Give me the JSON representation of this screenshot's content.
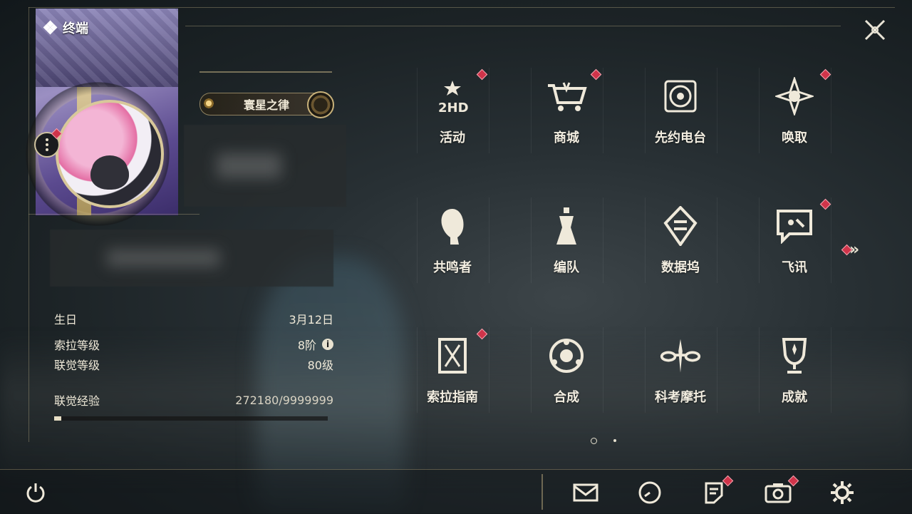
{
  "app": {
    "title": "终端"
  },
  "profile": {
    "title_badge": "寰星之律",
    "stats": [
      {
        "label": "生日",
        "value": "3月12日"
      },
      {
        "label": "索拉等级",
        "value": "8阶"
      },
      {
        "label": "联觉等级",
        "value": "80级"
      }
    ],
    "exp": {
      "label": "联觉经验",
      "value": "272180/9999999",
      "progress_fraction": 0.027
    }
  },
  "menu": {
    "items": [
      {
        "key": "activity",
        "label": "活动",
        "icon": "event-2hd-icon",
        "badge": true
      },
      {
        "key": "shop",
        "label": "商城",
        "icon": "cart-crown-icon",
        "badge": true
      },
      {
        "key": "radio",
        "label": "先约电台",
        "icon": "radio-record-icon",
        "badge": false
      },
      {
        "key": "convene",
        "label": "唤取",
        "icon": "compass-star-icon",
        "badge": true
      },
      {
        "key": "resonators",
        "label": "共鸣者",
        "icon": "character-head-icon",
        "badge": false
      },
      {
        "key": "team",
        "label": "编队",
        "icon": "chess-pieces-icon",
        "badge": false
      },
      {
        "key": "databank",
        "label": "数据坞",
        "icon": "data-diamond-icon",
        "badge": false
      },
      {
        "key": "messages",
        "label": "飞讯",
        "icon": "chat-bubble-icon",
        "badge": true
      },
      {
        "key": "guide",
        "label": "索拉指南",
        "icon": "guide-book-icon",
        "badge": true
      },
      {
        "key": "synthesis",
        "label": "合成",
        "icon": "synthesis-ring-icon",
        "badge": false
      },
      {
        "key": "motorcycle",
        "label": "科考摩托",
        "icon": "motorcycle-icon",
        "badge": false
      },
      {
        "key": "achievements",
        "label": "成就",
        "icon": "trophy-icon",
        "badge": false
      }
    ]
  },
  "bottom": {
    "icons": [
      "mail-icon",
      "clock-icon",
      "notice-icon",
      "camera-icon",
      "settings-gear-icon"
    ]
  },
  "colors": {
    "badge_red": "#d0344a",
    "gold": "#d8c89a",
    "text": "#f2ede0"
  }
}
